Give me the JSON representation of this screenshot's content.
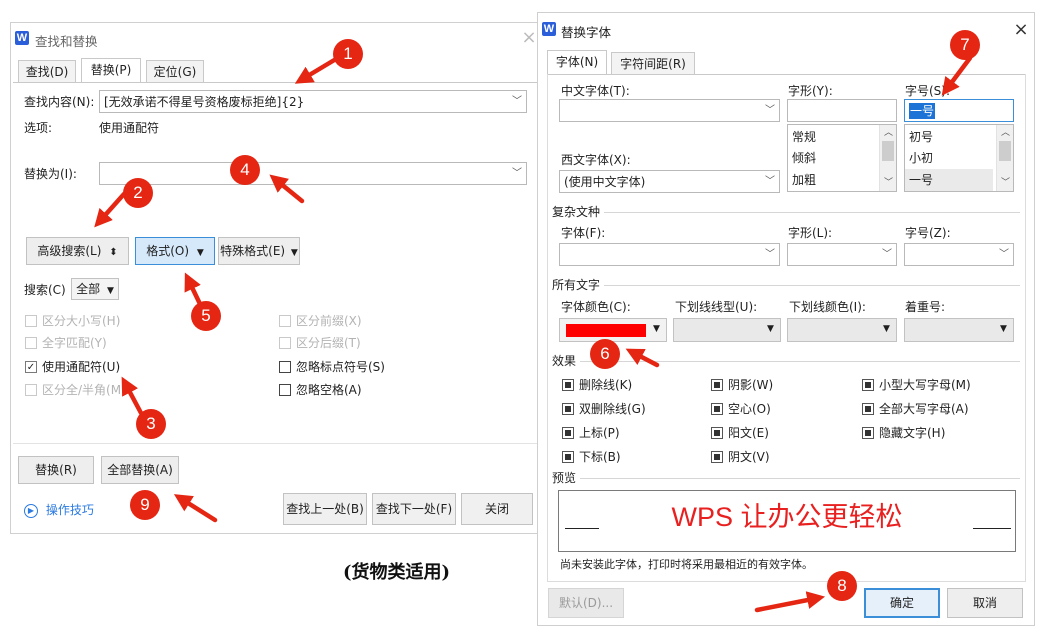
{
  "find_dialog": {
    "title": "查找和替换",
    "tabs": [
      "查找(D)",
      "替换(P)",
      "定位(G)"
    ],
    "find_label": "查找内容(N):",
    "find_value": "[无效承诺不得星号资格废标拒绝]{2}",
    "options_label": "选项:",
    "options_value": "使用通配符",
    "replace_label": "替换为(I):",
    "replace_value": "",
    "advanced_button": "高级搜索(L)",
    "format_button": "格式(O)",
    "special_button": "特殊格式(E)",
    "search_label": "搜索(C)",
    "search_value": "全部",
    "checkboxes_left": [
      {
        "label": "区分大小写(H)",
        "checked": false,
        "disabled": true
      },
      {
        "label": "全字匹配(Y)",
        "checked": false,
        "disabled": true
      },
      {
        "label": "使用通配符(U)",
        "checked": true,
        "disabled": false
      },
      {
        "label": "区分全/半角(M)",
        "checked": false,
        "disabled": true
      }
    ],
    "checkboxes_right": [
      {
        "label": "区分前缀(X)",
        "checked": false,
        "disabled": true
      },
      {
        "label": "区分后缀(T)",
        "checked": false,
        "disabled": true
      },
      {
        "label": "忽略标点符号(S)",
        "checked": false,
        "disabled": false
      },
      {
        "label": "忽略空格(A)",
        "checked": false,
        "disabled": false
      }
    ],
    "replace_button": "替换(R)",
    "replace_all_button": "全部替换(A)",
    "tips_link": "操作技巧",
    "find_prev_button": "查找上一处(B)",
    "find_next_button": "查找下一处(F)",
    "close_button": "关闭"
  },
  "caption": "(货物类适用)",
  "font_dialog": {
    "title": "替换字体",
    "tabs": [
      "字体(N)",
      "字符间距(R)"
    ],
    "cn_font_label": "中文字体(T):",
    "cn_font_value": "",
    "style_label": "字形(Y):",
    "style_value": "",
    "style_options": [
      "常规",
      "倾斜",
      "加粗"
    ],
    "size_label": "字号(S):",
    "size_value": "一号",
    "size_options": [
      "初号",
      "小初",
      "一号"
    ],
    "west_font_label": "西文字体(X):",
    "west_font_value": "(使用中文字体)",
    "complex_section": "复杂文种",
    "complex_font_label": "字体(F):",
    "complex_style_label": "字形(L):",
    "complex_size_label": "字号(Z):",
    "all_text_section": "所有文字",
    "font_color_label": "字体颜色(C):",
    "font_color_value": "#ff0000",
    "underline_type_label": "下划线线型(U):",
    "underline_color_label": "下划线颜色(I):",
    "emphasis_label": "着重号:",
    "effects_section": "效果",
    "effects": [
      [
        "删除线(K)",
        "阴影(W)",
        "小型大写字母(M)"
      ],
      [
        "双删除线(G)",
        "空心(O)",
        "全部大写字母(A)"
      ],
      [
        "上标(P)",
        "阳文(E)",
        "隐藏文字(H)"
      ],
      [
        "下标(B)",
        "阴文(V)",
        ""
      ]
    ],
    "preview_section": "预览",
    "preview_text": "WPS 让办公更轻松",
    "preview_color": "#e8201f",
    "notice": "尚未安装此字体，打印时将采用最相近的有效字体。",
    "default_button": "默认(D)...",
    "ok_button": "确定",
    "cancel_button": "取消"
  },
  "annotations": [
    "1",
    "2",
    "3",
    "4",
    "5",
    "6",
    "7",
    "8",
    "9"
  ],
  "colors": {
    "badge": "#e42613",
    "arrow": "#e42613",
    "accent": "#3b8fd9"
  }
}
